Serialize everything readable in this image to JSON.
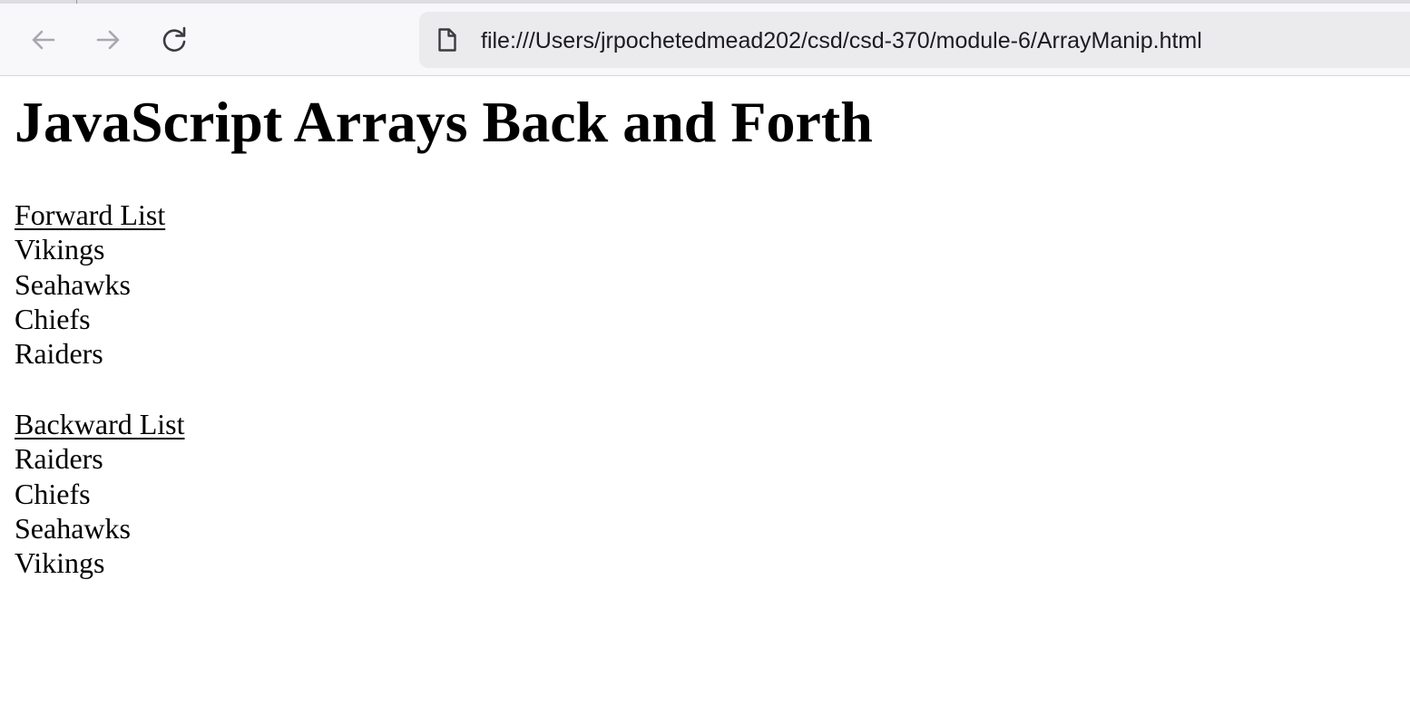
{
  "browser": {
    "url": "file:///Users/jrpochetedmead202/csd/csd-370/module-6/ArrayManip.html",
    "nav_icons": [
      "back-arrow-icon",
      "forward-arrow-icon",
      "reload-icon"
    ],
    "url_icon": "file-icon"
  },
  "page": {
    "title": "JavaScript Arrays Back and Forth",
    "forward": {
      "heading": "Forward List",
      "items": [
        "Vikings",
        "Seahawks",
        "Chiefs",
        "Raiders"
      ]
    },
    "backward": {
      "heading": "Backward List",
      "items": [
        "Raiders",
        "Chiefs",
        "Seahawks",
        "Vikings"
      ]
    }
  }
}
